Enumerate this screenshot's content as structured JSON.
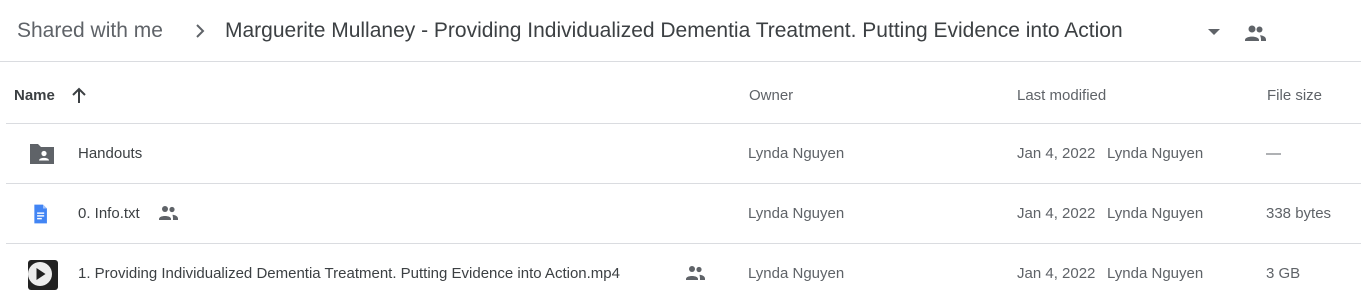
{
  "breadcrumb": {
    "root": "Shared with me",
    "current": "Marguerite Mullaney - Providing Individualized Dementia Treatment. Putting Evidence into Action"
  },
  "columns": {
    "name": "Name",
    "owner": "Owner",
    "last_modified": "Last modified",
    "file_size": "File size"
  },
  "sort": {
    "column": "Name",
    "direction": "ascending"
  },
  "rows": [
    {
      "name": "Handouts",
      "type": "shared-folder",
      "icon": "shared-folder-icon",
      "shared": false,
      "owner": "Lynda Nguyen",
      "modified_date": "Jan 4, 2022",
      "modified_by": "Lynda Nguyen",
      "size": "—"
    },
    {
      "name": "0. Info.txt",
      "type": "document",
      "icon": "google-doc-icon",
      "shared": true,
      "owner": "Lynda Nguyen",
      "modified_date": "Jan 4, 2022",
      "modified_by": "Lynda Nguyen",
      "size": "338 bytes"
    },
    {
      "name": "1. Providing Individualized Dementia Treatment.  Putting Evidence into Action.mp4",
      "type": "video",
      "icon": "video-thumbnail",
      "shared": true,
      "owner": "Lynda Nguyen",
      "modified_date": "Jan 4, 2022",
      "modified_by": "Lynda Nguyen",
      "size": "3 GB"
    }
  ],
  "colors": {
    "primary_text": "#3c4043",
    "secondary_text": "#5f6368",
    "divider": "#dadce0",
    "doc_blue": "#4285f4"
  }
}
